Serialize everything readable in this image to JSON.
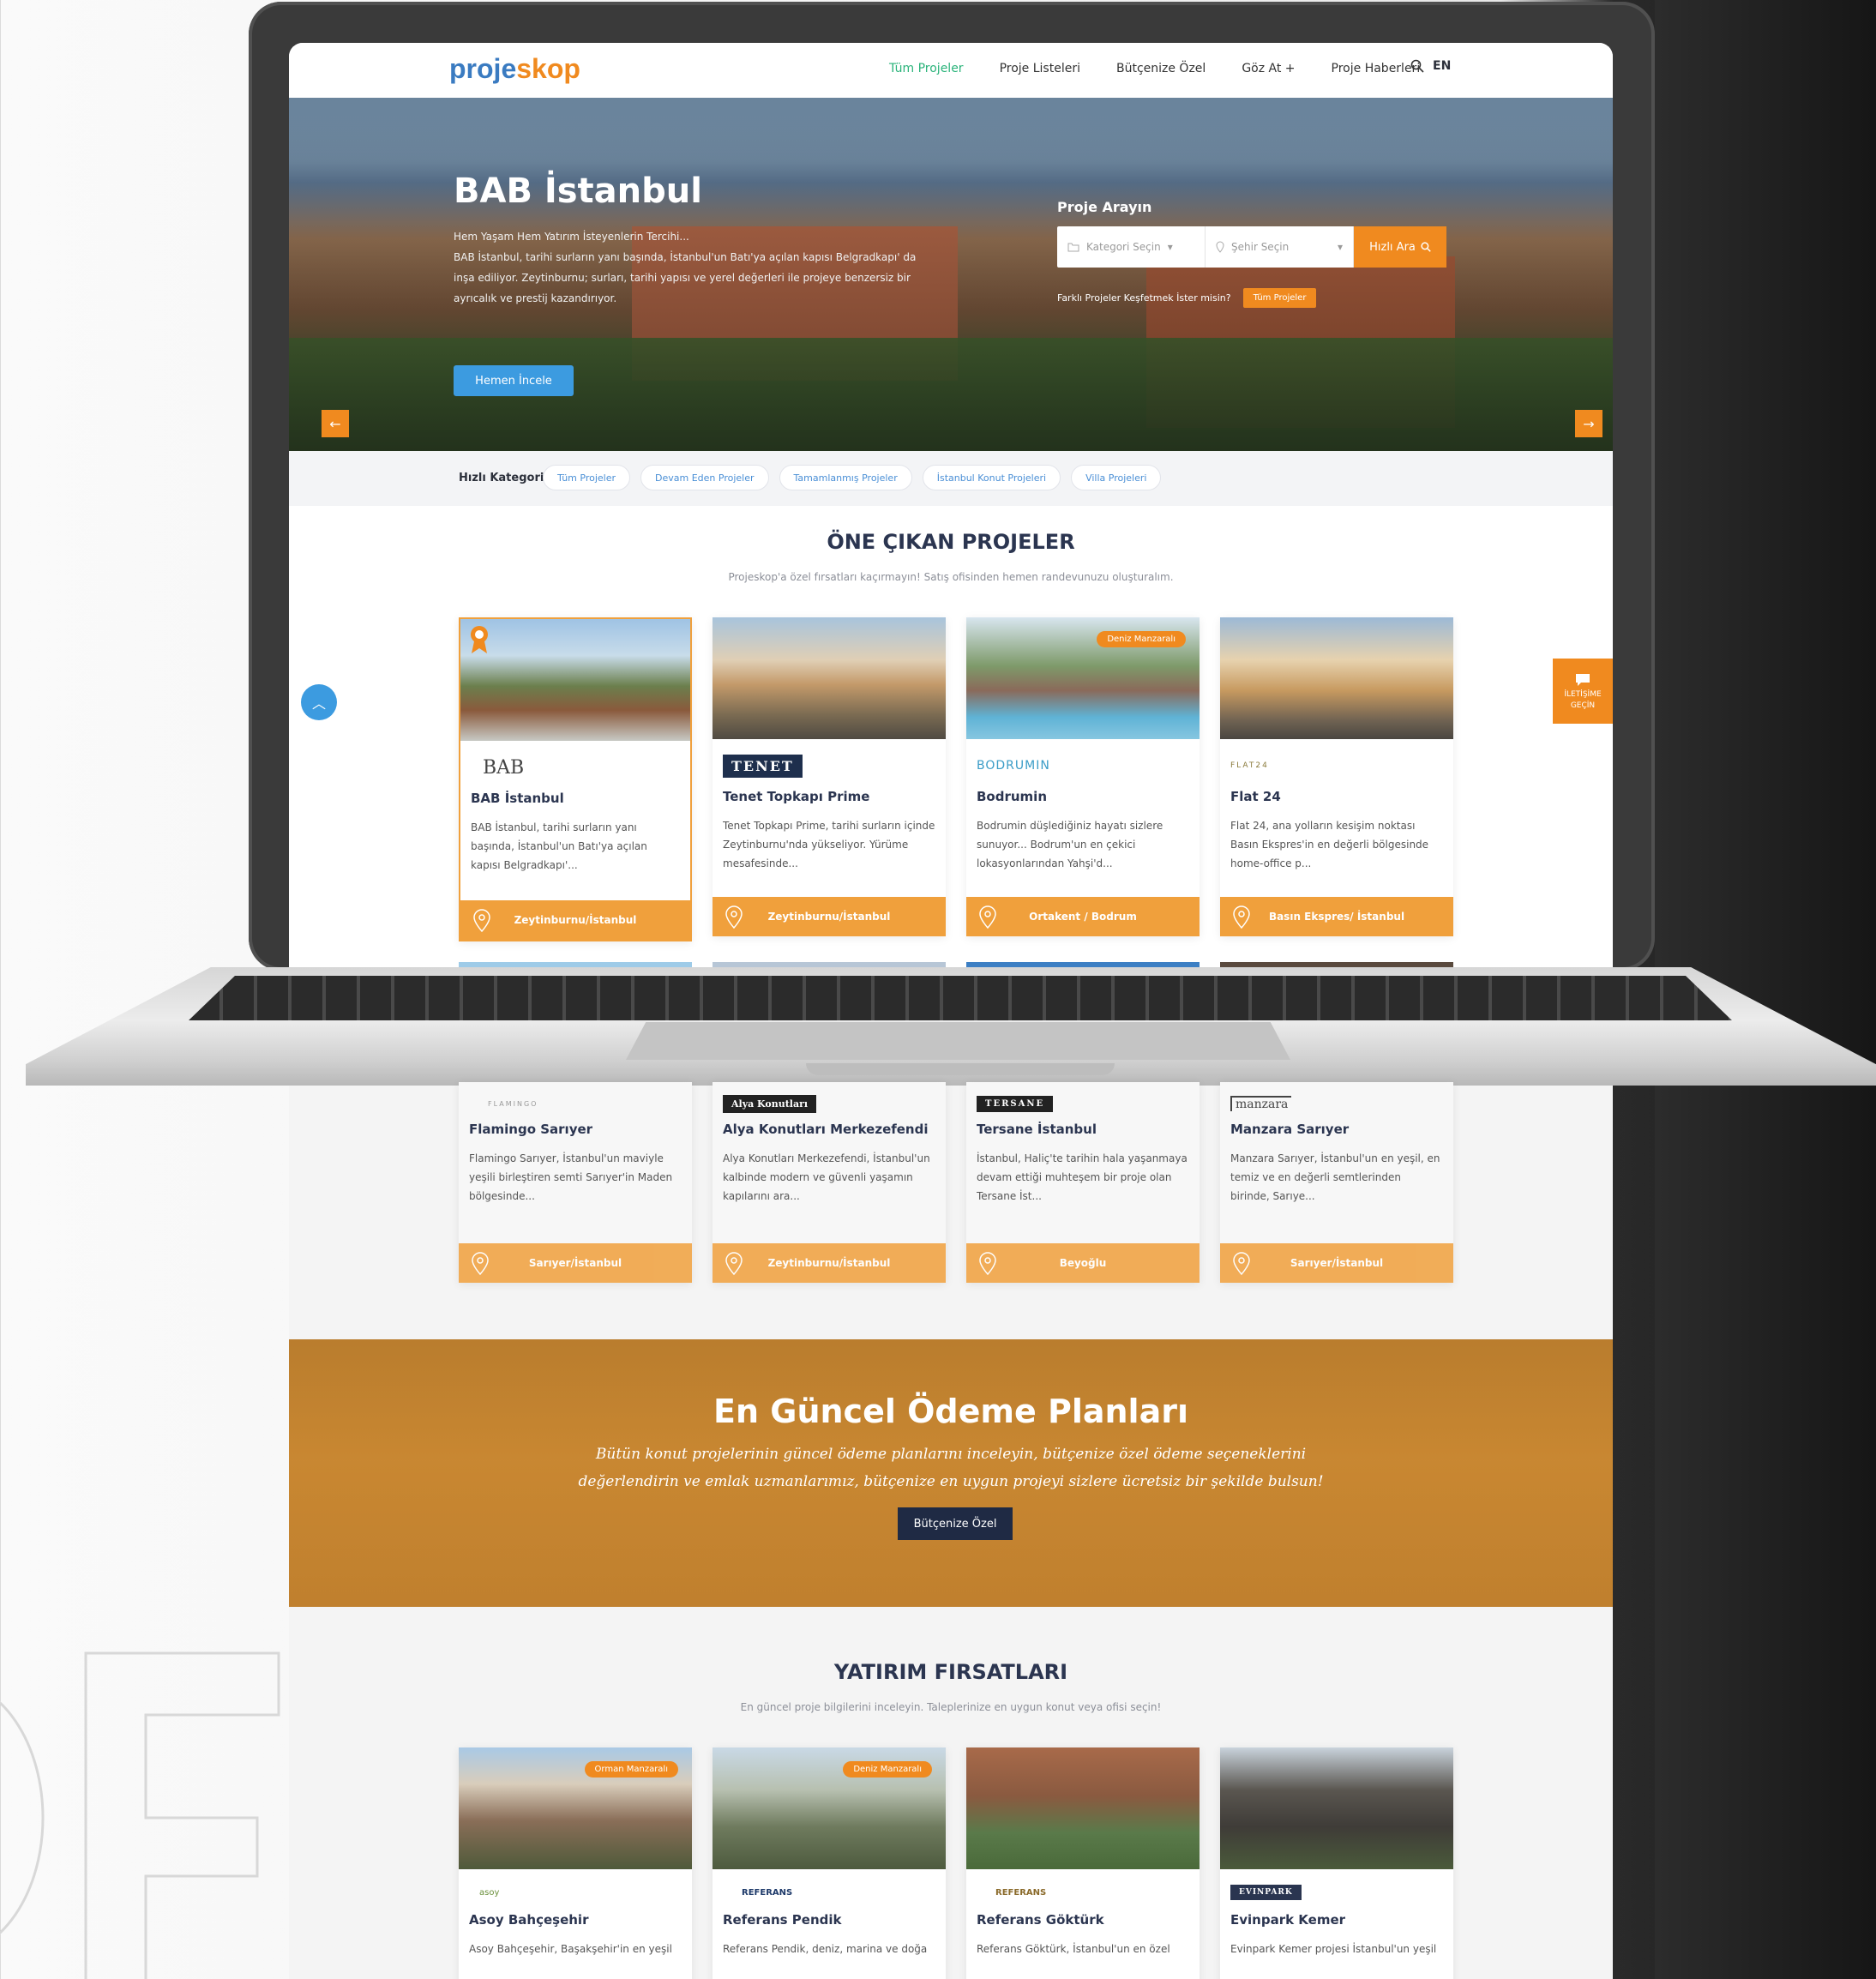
{
  "brand": {
    "logo_part1": "proje",
    "logo_part2": "skop",
    "accent": "#f08a1f",
    "blue": "#3c9be0"
  },
  "nav": {
    "items": [
      "Tüm Projeler",
      "Proje Listeleri",
      "Bütçenize Özel",
      "Göz At +",
      "Proje Haberleri"
    ],
    "lang": "EN"
  },
  "hero": {
    "title": "BAB İstanbul",
    "text_line1": "Hem Yaşam Hem Yatırım İsteyenlerin Tercihi...",
    "text_body": "BAB İstanbul, tarihi surların yanı başında, İstanbul'un Batı'ya açılan kapısı Belgradkapı' da inşa ediliyor. Zeytinburnu; surları, tarihi yapısı ve yerel değerleri ile projeye benzersiz bir ayrıcalık ve prestij kazandırıyor.",
    "button": "Hemen İncele",
    "search_title": "Proje Arayın",
    "category_placeholder": "Kategori Seçin",
    "city_placeholder": "Şehir Seçin",
    "search_button": "Hızlı Ara",
    "explore_text": "Farklı Projeler Keşfetmek İster misin?",
    "explore_button": "Tüm Projeler"
  },
  "quick_category": {
    "label": "Hızlı Kategori",
    "chips": [
      "Tüm Projeler",
      "Devam Eden Projeler",
      "Tamamlanmış Projeler",
      "İstanbul Konut Projeleri",
      "Villa Projeleri"
    ]
  },
  "featured": {
    "title": "ÖNE ÇIKAN PROJELER",
    "subtitle": "Projeskop'a özel fırsatları kaçırmayın! Satış ofisinden hemen randevunuzu oluşturalım.",
    "cards": [
      {
        "logo": "BAB",
        "name": "BAB İstanbul",
        "desc": "BAB İstanbul, tarihi surların yanı başında, İstanbul'un Batı'ya açılan kapısı Belgradkapı'...",
        "location": "Zeytinburnu/İstanbul"
      },
      {
        "logo": "TENET",
        "name": "Tenet Topkapı Prime",
        "desc": "Tenet Topkapı Prime, tarihi surların içinde Zeytinburnu'nda yükseliyor. Yürüme mesafesinde...",
        "location": "Zeytinburnu/İstanbul"
      },
      {
        "logo": "BODRUMIN",
        "name": "Bodrumin",
        "desc": "Bodrumin düşlediğiniz hayatı sizlere sunuyor... Bodrum'un en çekici lokasyonlarından Yahşi'd...",
        "location": "Ortakent / Bodrum",
        "badge": "Deniz Manzaralı"
      },
      {
        "logo": "FLAT24",
        "name": "Flat 24",
        "desc": "Flat 24, ana yolların kesişim noktası Basın Ekspres'in en değerli bölgesinde home-office p...",
        "location": "Basın Ekspres/ İstanbul"
      }
    ],
    "cards_row2": [
      {
        "logo": "FLAMINGO",
        "name": "Flamingo Sarıyer",
        "desc": "Flamingo Sarıyer, İstanbul'un maviyle yeşili birleştiren semti Sarıyer'in Maden bölgesinde...",
        "location": "Sarıyer/İstanbul"
      },
      {
        "logo": "Alya Konutları",
        "name": "Alya Konutları Merkezefendi",
        "desc": "Alya Konutları Merkezefendi, İstanbul'un kalbinde modern ve güvenli yaşamın kapılarını ara...",
        "location": "Zeytinburnu/İstanbul"
      },
      {
        "logo": "TERSANE",
        "name": "Tersane İstanbul",
        "desc": "İstanbul, Haliç'te tarihin hala yaşanmaya devam ettiği muhteşem bir proje olan Tersane İst...",
        "location": "Beyoğlu"
      },
      {
        "logo": "manzara",
        "name": "Manzara Sarıyer",
        "desc": "Manzara Sarıyer, İstanbul'un en yeşil, en temiz ve en değerli semtlerinden birinde, Sarıye...",
        "location": "Sarıyer/İstanbul"
      }
    ]
  },
  "contact": {
    "label_line1": "İLETİŞİME",
    "label_line2": "GEÇİN"
  },
  "payment": {
    "title": "En Güncel Ödeme Planları",
    "text_line1": "Bütün konut projelerinin güncel ödeme planlarını inceleyin, bütçenize özel ödeme seçeneklerini",
    "text_line2": "değerlendirin ve emlak uzmanlarımız, bütçenize en uygun projeyi sizlere ücretsiz bir şekilde bulsun!",
    "button": "Bütçenize Özel"
  },
  "investment": {
    "title": "YATIRIM FIRSATLARI",
    "subtitle": "En güncel proje bilgilerini inceleyin. Taleplerinize en uygun konut veya ofisi seçin!",
    "cards": [
      {
        "logo": "asoy",
        "name": "Asoy Bahçeşehir",
        "desc": "Asoy Bahçeşehir, Başakşehir'in en yeşil",
        "badge": "Orman Manzaralı"
      },
      {
        "logo": "REFERANS",
        "name": "Referans Pendik",
        "desc": "Referans Pendik, deniz, marina ve doğa",
        "badge": "Deniz Manzaralı"
      },
      {
        "logo": "REFERANS",
        "name": "Referans Göktürk",
        "desc": "Referans Göktürk, İstanbul'un en özel"
      },
      {
        "logo": "EVINPARK",
        "name": "Evinpark Kemer",
        "desc": "Evinpark Kemer projesi İstanbul'un yeşil"
      }
    ]
  }
}
